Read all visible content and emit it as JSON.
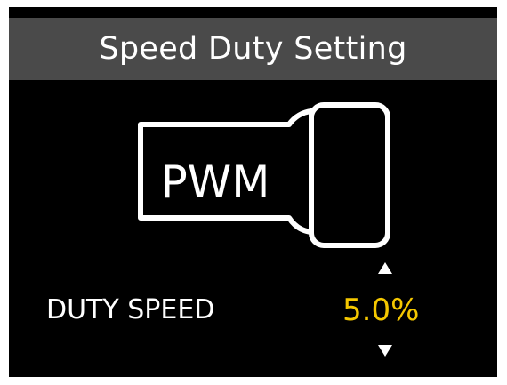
{
  "header": {
    "title": "Speed Duty Setting"
  },
  "graphic": {
    "label": "PWM",
    "icon": "pwm-plug-icon"
  },
  "setting": {
    "label": "DUTY SPEED",
    "value": "5.0%",
    "value_color": "#f5c800",
    "increase_icon": "triangle-up-icon",
    "decrease_icon": "triangle-down-icon"
  }
}
